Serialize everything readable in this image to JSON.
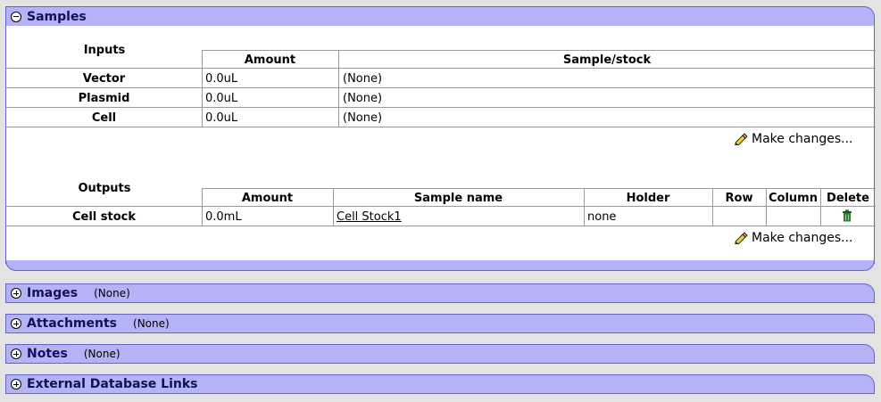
{
  "samples": {
    "title": "Samples",
    "inputs": {
      "label": "Inputs",
      "columns": [
        "Amount",
        "Sample/stock"
      ],
      "rows": [
        {
          "name": "Vector",
          "amount": "0.0uL",
          "sample": "(None)"
        },
        {
          "name": "Plasmid",
          "amount": "0.0uL",
          "sample": "(None)"
        },
        {
          "name": "Cell",
          "amount": "0.0uL",
          "sample": "(None)"
        }
      ],
      "make_changes": "Make changes..."
    },
    "outputs": {
      "label": "Outputs",
      "columns": [
        "Amount",
        "Sample name",
        "Holder",
        "Row",
        "Column",
        "Delete"
      ],
      "rows": [
        {
          "name": "Cell stock",
          "amount": "0.0mL",
          "sample_name": "Cell Stock1",
          "holder": "none",
          "row": "",
          "column": ""
        }
      ],
      "make_changes": "Make changes..."
    }
  },
  "panels": [
    {
      "title": "Images",
      "note": "(None)"
    },
    {
      "title": "Attachments",
      "note": "(None)"
    },
    {
      "title": "Notes",
      "note": "(None)"
    },
    {
      "title": "External Database Links",
      "note": ""
    }
  ],
  "icons": {
    "collapse": "minus-circle-icon",
    "expand": "plus-circle-icon",
    "edit": "pencil-icon",
    "delete": "trash-icon"
  },
  "colors": {
    "header_bg": "#b3b3f5",
    "border": "#6464c8",
    "trash": "#2e7d32"
  }
}
